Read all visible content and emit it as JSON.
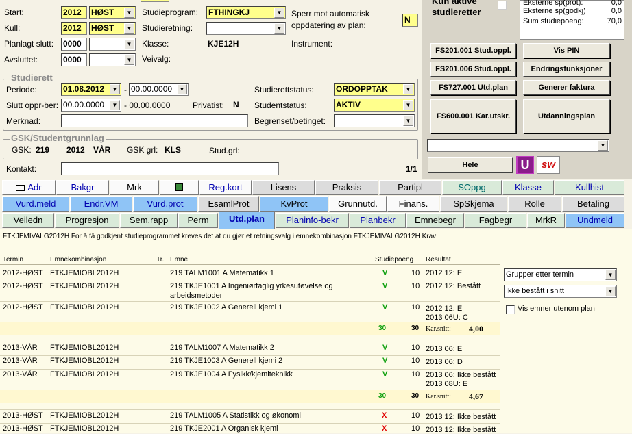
{
  "left_form": {
    "start_label": "Start:",
    "start_year": "2012",
    "start_term": "HØST",
    "kull_label": "Kull:",
    "kull_year": "2012",
    "kull_term": "HØST",
    "planlagt_label": "Planlagt slutt:",
    "planlagt_year": "0000",
    "planlagt_term": "",
    "avsluttet_label": "Avsluttet:",
    "avsluttet_year": "0000",
    "avsluttet_term": "",
    "studieprogram_label": "Studieprogram:",
    "studieprogram_value": "FTHINGKJ",
    "studieretning_label": "Studieretning:",
    "studieretning_value": "",
    "klasse_label": "Klasse:",
    "klasse_value": "KJE12H",
    "veivalg_label": "Veivalg:",
    "sperr_label": "Sperr mot automatisk oppdatering av plan:",
    "sperr_value": "N",
    "instrument_label": "Instrument:"
  },
  "studierett": {
    "title": "Studierett",
    "periode_label": "Periode:",
    "periode_from": "01.08.2012",
    "periode_to": "00.00.0000",
    "slutt_label": "Slutt oppr-ber:",
    "slutt_from": "00.00.0000",
    "slutt_to": "- 00.00.0000",
    "privatist_label": "Privatist:",
    "privatist_value": "N",
    "merknad_label": "Merknad:",
    "merknad_value": "",
    "studierettstatus_label": "Studierettstatus:",
    "studierettstatus_value": "ORDOPPTAK",
    "studentstatus_label": "Studentstatus:",
    "studentstatus_value": "AKTIV",
    "begrenset_label": "Begrenset/betinget:",
    "begrenset_value": ""
  },
  "gsk": {
    "title": "GSK/Studentgrunnlag",
    "gsk_label": "GSK:",
    "gsk_value": "219",
    "gsk_year": "2012",
    "gsk_term": "VÅR",
    "grl_label": "GSK grl:",
    "grl_value": "KLS",
    "stud_grl_label": "Stud.grl:"
  },
  "kontakt": {
    "label": "Kontakt:",
    "value": "",
    "counter": "1/1"
  },
  "right_panel": {
    "aktive_label": "Kun aktive studieretter",
    "sp_rows": [
      {
        "label": "Eksterne sp(prot):",
        "value": "0,0"
      },
      {
        "label": "Eksterne sp(godkj)",
        "value": "0,0"
      },
      {
        "label": "Sum studiepoeng:",
        "value": "70,0"
      }
    ],
    "buttons": {
      "fs201_001": "FS201.001 Stud.oppl.",
      "vis_pin": "Vis PIN",
      "fs201_006": "FS201.006 Stud.oppl.",
      "endringsfunksjoner": "Endringsfunksjoner",
      "fs727": "FS727.001 Utd.plan",
      "generer_faktura": "Generer faktura",
      "fs600": "FS600.001 Kar.utskr.",
      "utdanningsplan": "Utdanningsplan",
      "hele": "Hele"
    },
    "sw_logo": "sw"
  },
  "tabs": {
    "row1": [
      "Adr",
      "Bakgr",
      "Mrk",
      "",
      "Reg.kort",
      "Lisens",
      "Praksis",
      "Partipl",
      "SOppg",
      "Klasse",
      "Kullhist"
    ],
    "row2": [
      "Vurd.meld",
      "Endr.VM",
      "Vurd.prot",
      "EsamlProt",
      "KvProt",
      "Grunnutd.",
      "Finans.",
      "SpSkjema",
      "Rolle",
      "Betaling"
    ],
    "row3": [
      "Veiledn",
      "Progresjon",
      "Sem.rapp",
      "Perm",
      "Utd.plan",
      "Planinfo-bekr",
      "Planbekr",
      "Emnebegr",
      "Fagbegr",
      "MrkR",
      "Undmeld"
    ]
  },
  "plan": {
    "info_text": "FTKJEMIVALG2012H For å få godkjent studieprogrammet kreves det at du gjør et retningsvalg i emnekombinasjon FTKJEMIVALG2012H Krav",
    "headers": {
      "termin": "Termin",
      "emnekomb": "Emnekombinasjon",
      "tr": "Tr.",
      "emne": "Emne",
      "studiepoeng": "Studiepoeng",
      "resultat": "Resultat"
    },
    "rows": [
      {
        "termin": "2012-HØST",
        "komb": "FTKJEMIOBL2012H",
        "emne": "219 TALM1001 A Matematikk 1",
        "mark": "V",
        "sp": "10",
        "res1": "2012 12: E",
        "res2": ""
      },
      {
        "termin": "2012-HØST",
        "komb": "FTKJEMIOBL2012H",
        "emne": "219 TKJE1001 A Ingeniørfaglig yrkesutøvelse og",
        "emne2": "arbeidsmetoder",
        "mark": "V",
        "sp": "10",
        "res1": "2012 12: Bestått",
        "res2": ""
      },
      {
        "termin": "2012-HØST",
        "komb": "FTKJEMIOBL2012H",
        "emne": "219 TKJE1002 A Generell kjemi 1",
        "mark": "V",
        "sp": "10",
        "res1": "2012 12: E",
        "res2": "2013 06U: C"
      },
      {
        "termin": "2013-VÅR",
        "komb": "FTKJEMIOBL2012H",
        "emne": "219 TALM1007 A Matematikk 2",
        "mark": "V",
        "sp": "10",
        "res1": "2013 06: E",
        "res2": ""
      },
      {
        "termin": "2013-VÅR",
        "komb": "FTKJEMIOBL2012H",
        "emne": "219 TKJE1003 A Generell kjemi 2",
        "mark": "V",
        "sp": "10",
        "res1": "2013 06: D",
        "res2": ""
      },
      {
        "termin": "2013-VÅR",
        "komb": "FTKJEMIOBL2012H",
        "emne": "219 TKJE1004 A Fysikk/kjemiteknikk",
        "mark": "V",
        "sp": "10",
        "res1": "2013 06: Ikke bestått",
        "res2": "2013 08U: E"
      },
      {
        "termin": "2013-HØST",
        "komb": "FTKJEMIOBL2012H",
        "emne": "219 TALM1005 A Statistikk og økonomi",
        "mark": "X",
        "sp": "10",
        "res1": "2013 12: Ikke bestått",
        "res2": ""
      },
      {
        "termin": "2013-HØST",
        "komb": "FTKJEMIOBL2012H",
        "emne": "219 TKJE2001 A Organisk kjemi",
        "mark": "X",
        "sp": "10",
        "res1": "2013 12: Ikke bestått",
        "res2": ""
      }
    ],
    "sums": [
      {
        "sp_green": "30",
        "sp": "30",
        "karsnitt_label": "Kar.snitt:",
        "karsnitt": "4,00"
      },
      {
        "sp_green": "30",
        "sp": "30",
        "karsnitt_label": "Kar.snitt:",
        "karsnitt": "4,67"
      }
    ],
    "controls": {
      "grupper": "Grupper etter termin",
      "ikke_bestatt": "Ikke bestått i snitt",
      "vis_emner": "Vis emner utenom plan"
    }
  }
}
